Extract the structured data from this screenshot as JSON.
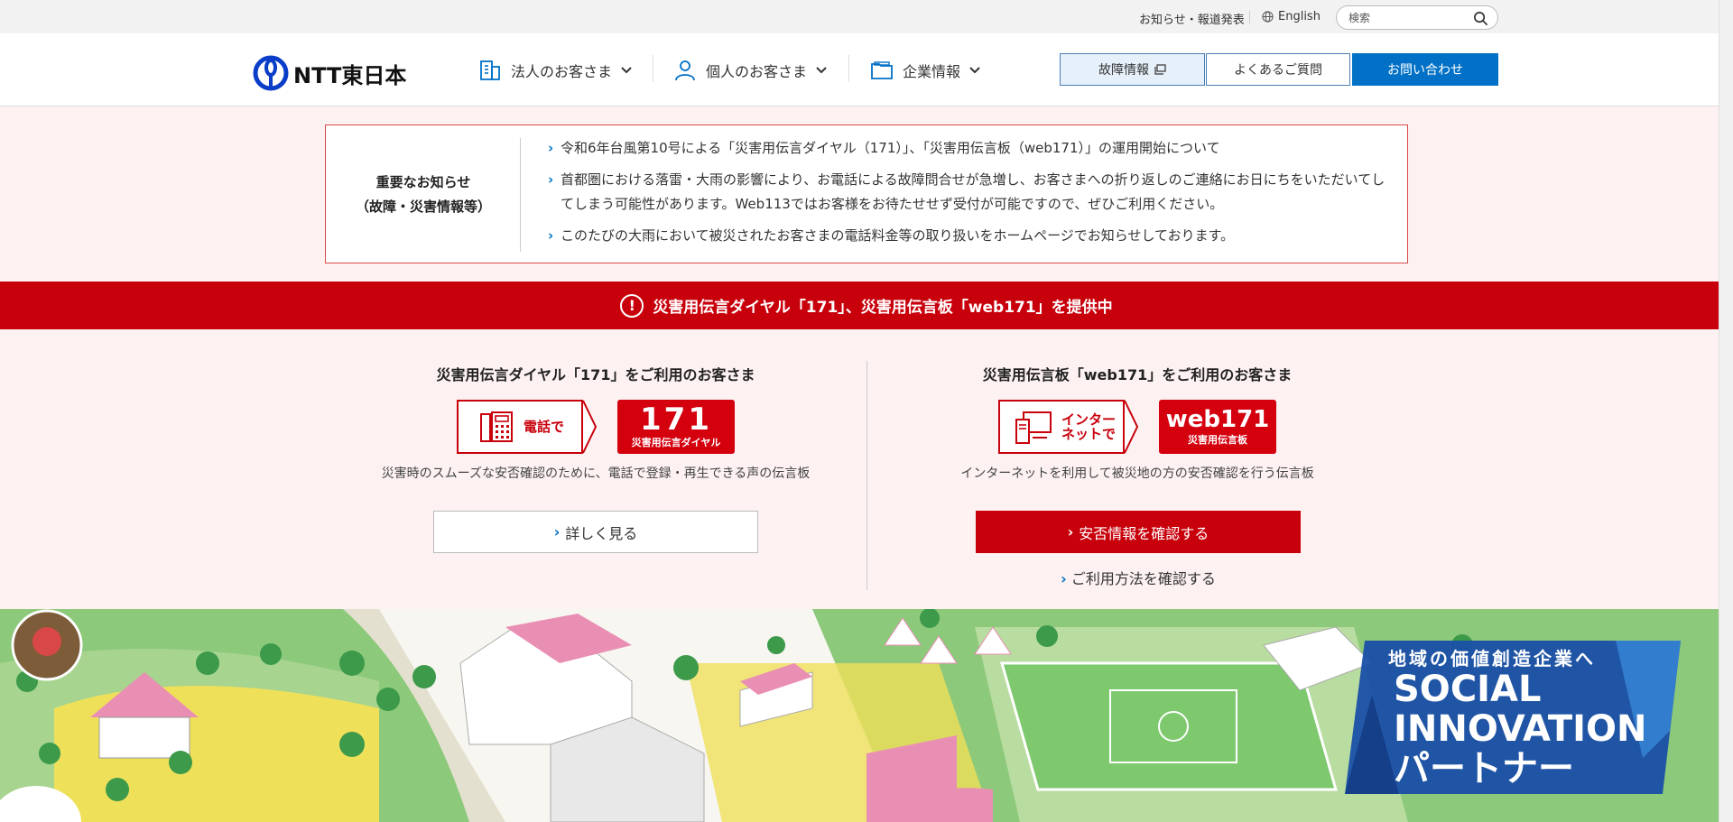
{
  "utility": {
    "news_link": "お知らせ・報道発表",
    "language_link": "English",
    "search_placeholder": "検索"
  },
  "header": {
    "logo_text": "NTT東日本",
    "nav": [
      {
        "label": "法人のお客さま"
      },
      {
        "label": "個人のお客さま"
      },
      {
        "label": "企業情報"
      }
    ],
    "buttons": {
      "trouble": "故障情報",
      "faq": "よくあるご質問",
      "contact": "お問い合わせ"
    }
  },
  "notice": {
    "title_line1": "重要なお知らせ",
    "title_line2": "（故障・災害情報等）",
    "items": [
      "令和6年台風第10号による「災害用伝言ダイヤル（171）」、「災害用伝言板（web171）」の運用開始について",
      "首都圏における落雷・大雨の影響により、お電話による故障問合せが急増し、お客さまへの折り返しのご連絡にお日にちをいただいてしてしまう可能性があります。Web113ではお客様をお待たせせず受付が可能ですので、ぜひご利用ください。",
      "このたびの大雨において被災されたお客さまの電話料金等の取り扱いをホームページでお知らせしております。"
    ]
  },
  "banner": {
    "text": "災害用伝言ダイヤル「171」、災害用伝言板「web171」を提供中"
  },
  "services": {
    "dial": {
      "title": "災害用伝言ダイヤル「171」をご利用のお客さま",
      "arrow_label": "電話で",
      "tile_big": "171",
      "tile_small": "災害用伝言ダイヤル",
      "description": "災害時のスムーズな安否確認のために、電話で登録・再生できる声の伝言板",
      "button": "詳しく見る"
    },
    "web": {
      "title": "災害用伝言板「web171」をご利用のお客さま",
      "arrow_label_line1": "インター",
      "arrow_label_line2": "ネットで",
      "tile_big": "web171",
      "tile_small": "災害用伝言板",
      "description": "インターネットを利用して被災地の方の安否確認を行う伝言板",
      "button": "安否情報を確認する",
      "link": "ご利用方法を確認する"
    }
  },
  "hero": {
    "promo_line1": "地域の価値創造企業へ",
    "promo_line2": "SOCIAL",
    "promo_line3": "INNOVATION",
    "promo_line4": "パートナー"
  },
  "colors": {
    "brand_red": "#c8000b",
    "brand_blue": "#0071c6",
    "notice_bg": "#fdf1f1"
  }
}
